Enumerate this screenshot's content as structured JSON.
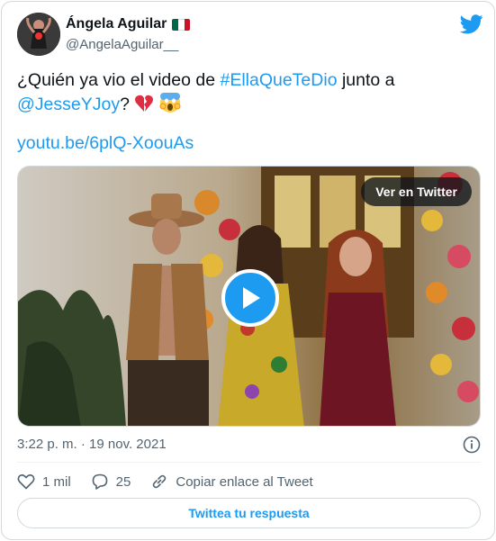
{
  "author": {
    "display_name": "Ángela Aguilar",
    "handle": "@AngelaAguilar__",
    "flag_colors": [
      "#006847",
      "#ffffff",
      "#ce1126"
    ]
  },
  "icons": {
    "brand": "twitter-bird-icon",
    "play": "play-icon",
    "info": "info-icon",
    "like": "heart-icon",
    "reply": "speech-bubble-icon",
    "copy": "link-icon"
  },
  "colors": {
    "accent": "#1d9bf0",
    "text": "#0f1419",
    "muted": "#536471",
    "border": "#cfd9de"
  },
  "tweet": {
    "text_start": "¿Quién ya vio el video de ",
    "hashtag": "#EllaQueTeDio",
    "text_mid": " junto a ",
    "mention": "@JesseYJoy",
    "text_end": "? ",
    "link": "youtu.be/6plQ-XoouAs"
  },
  "media": {
    "watch_label": "Ver en Twitter"
  },
  "meta": {
    "timestamp": "3:22 p. m. · 19 nov. 2021"
  },
  "actions": {
    "likes_count": "1 mil",
    "replies_count": "25",
    "copy_link_label": "Copiar enlace al Tweet"
  },
  "reply_button_label": "Twittea tu respuesta"
}
